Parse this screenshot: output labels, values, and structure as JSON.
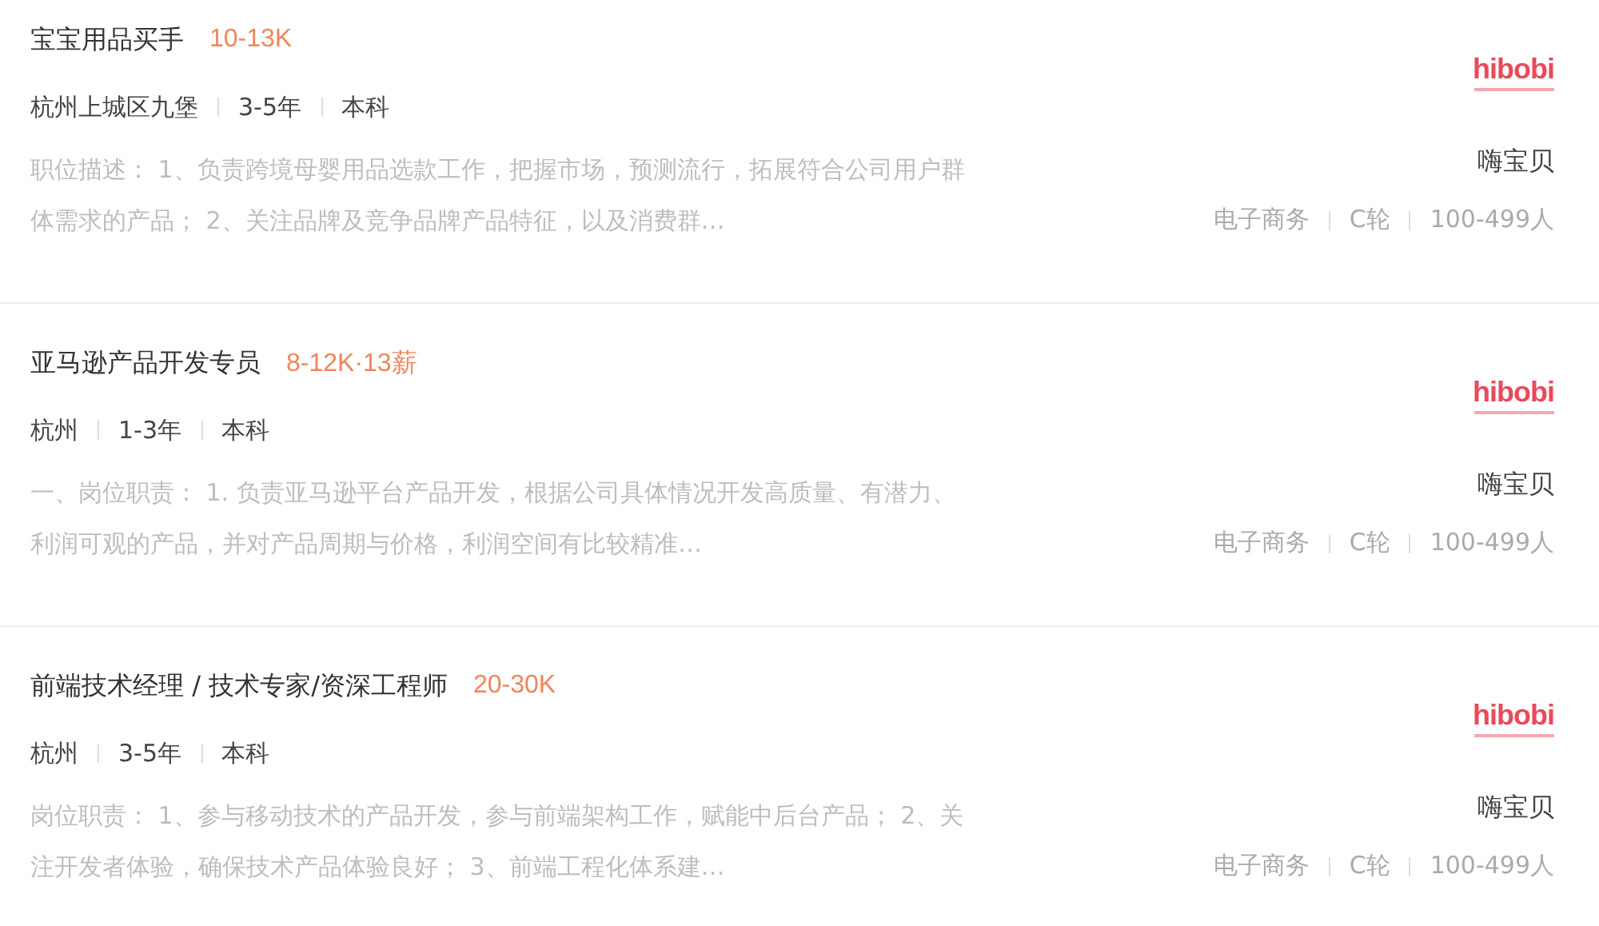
{
  "jobs": [
    {
      "title": "宝宝用品买手",
      "salary": "10-13K",
      "meta": [
        "杭州上城区九堡",
        "3-5年",
        "本科"
      ],
      "description": "职位描述： 1、负责跨境母婴用品选款工作，把握市场，预测流行，拓展符合公司用户群体需求的产品； 2、关注品牌及竞争品牌产品特征，以及消费群…",
      "company": {
        "logo": "hibobi",
        "name": "嗨宝贝",
        "tags": [
          "电子商务",
          "C轮",
          "100-499人"
        ]
      }
    },
    {
      "title": "亚马逊产品开发专员",
      "salary": "8-12K·13薪",
      "meta": [
        "杭州",
        "1-3年",
        "本科"
      ],
      "description": "一、岗位职责： 1. 负责亚马逊平台产品开发，根据公司具体情况开发高质量、有潜力、利润可观的产品，并对产品周期与价格，利润空间有比较精准…",
      "company": {
        "logo": "hibobi",
        "name": "嗨宝贝",
        "tags": [
          "电子商务",
          "C轮",
          "100-499人"
        ]
      }
    },
    {
      "title": "前端技术经理 / 技术专家/资深工程师",
      "salary": "20-30K",
      "meta": [
        "杭州",
        "3-5年",
        "本科"
      ],
      "description": "岗位职责： 1、参与移动技术的产品开发，参与前端架构工作，赋能中后台产品； 2、关注开发者体验，确保技术产品体验良好； 3、前端工程化体系建…",
      "company": {
        "logo": "hibobi",
        "name": "嗨宝贝",
        "tags": [
          "电子商务",
          "C轮",
          "100-499人"
        ]
      }
    }
  ]
}
